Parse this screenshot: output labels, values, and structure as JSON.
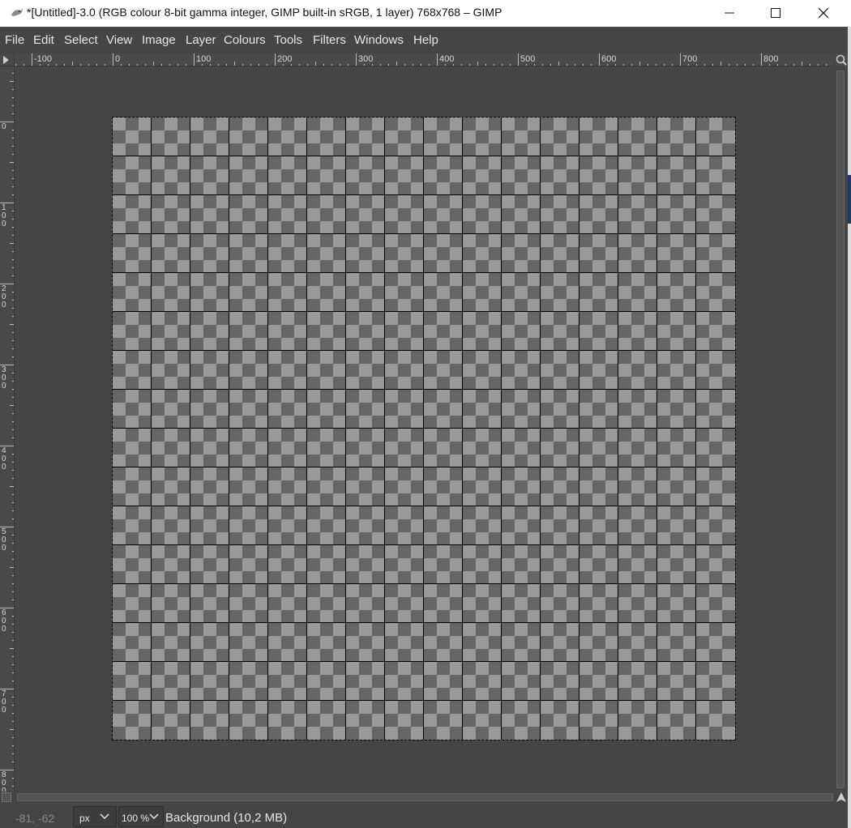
{
  "window": {
    "title": "*[Untitled]-3.0 (RGB colour 8-bit gamma integer, GIMP built-in sRGB, 1 layer) 768x768 – GIMP",
    "app_icon": "gimp-wilber-icon",
    "controls": [
      "minimize-icon",
      "maximize-icon",
      "close-icon"
    ]
  },
  "menubar": {
    "items": [
      "File",
      "Edit",
      "Select",
      "View",
      "Image",
      "Layer",
      "Colours",
      "Tools",
      "Filters",
      "Windows",
      "Help"
    ]
  },
  "rulers": {
    "horizontal_labels": [
      "-100",
      "0",
      "100",
      "200",
      "300",
      "400",
      "500",
      "600",
      "700",
      "800"
    ],
    "vertical_labels": [
      "0",
      "100",
      "200",
      "300",
      "400",
      "500",
      "600",
      "700",
      "800"
    ]
  },
  "canvas": {
    "image_width": 768,
    "image_height": 768,
    "grid_spacing": 48,
    "transparency_checker": true,
    "selection": "all"
  },
  "statusbar": {
    "pointer_coords": "-81, -62",
    "unit": "px",
    "zoom": "100 %",
    "layer_info": "Background (10,2 MB)"
  },
  "colors": {
    "background": "#454545",
    "checker_light": "#999999",
    "checker_dark": "#666666",
    "grid_line": "#000000",
    "text": "#e8e8e8"
  }
}
